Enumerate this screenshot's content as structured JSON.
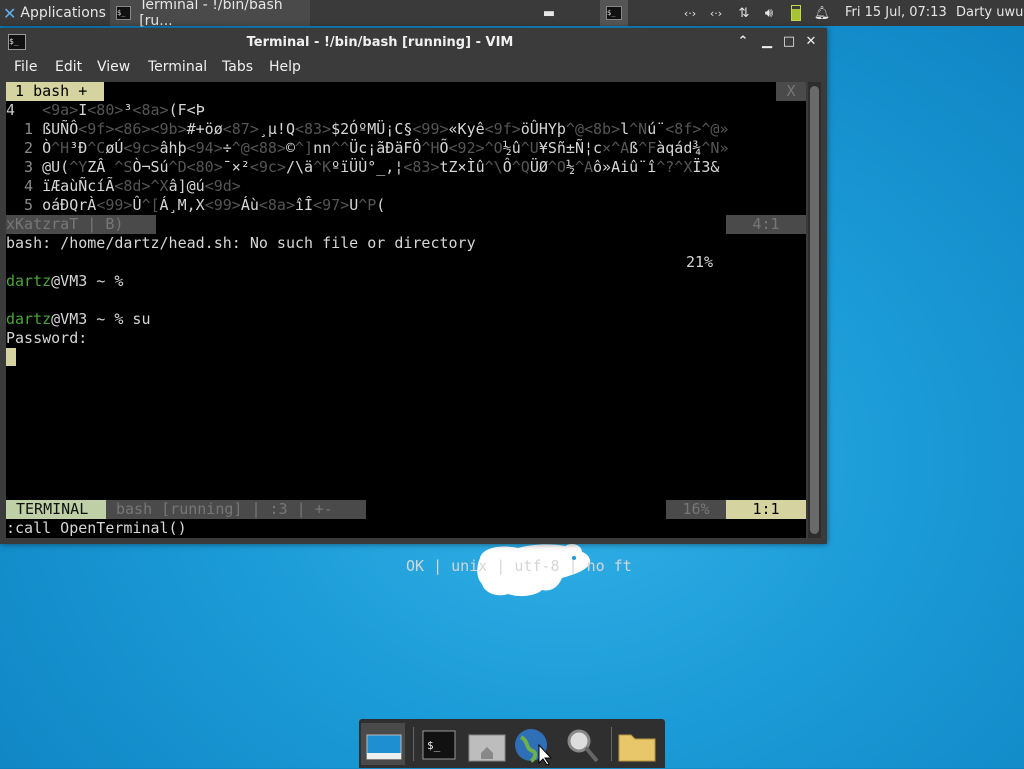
{
  "panel": {
    "applications_label": "Applications",
    "applications_suffix": "≡",
    "task_title": "Terminal - !/bin/bash [ru...",
    "clock": "Fri 15 Jul, 07:13",
    "user": "Darty uwu",
    "icons": [
      "app-x-icon",
      "window-min-icon",
      "workspace-icon",
      "network-icon",
      "network-icon",
      "transfer-icon",
      "volume-icon",
      "battery-icon",
      "notification-icon"
    ]
  },
  "window": {
    "title": "Terminal - !/bin/bash [running] - VIM",
    "menu": [
      "File",
      "Edit",
      "View",
      "Terminal",
      "Tabs",
      "Help"
    ]
  },
  "vim": {
    "tab_label": " 1 bash + ",
    "tab_close": "X",
    "line_cur_num": "4 ",
    "line_cur_a": "  <9a>",
    "line_cur_b": "I",
    "line_cur_c": "<80>",
    "line_cur_d": "³",
    "line_cur_e": "<8a>",
    "line_cur_f": "(F<Þ",
    "rows": [
      {
        "n": "1",
        "segs": [
          [
            "w",
            "ßUÑÔ"
          ],
          [
            "g",
            "<9f><86><9b>"
          ],
          [
            "w",
            "#+öø"
          ],
          [
            "g",
            "<87>"
          ],
          [
            "w",
            "¸µ!Q"
          ],
          [
            "g",
            "<83>"
          ],
          [
            "w",
            "$2ÓºMÜ¡C§"
          ],
          [
            "g",
            "<99>"
          ],
          [
            "w",
            "«Kyê"
          ],
          [
            "g",
            "<9f>"
          ],
          [
            "w",
            "öÛHYþ"
          ],
          [
            "g",
            "^@<8b>"
          ],
          [
            "w",
            "l"
          ],
          [
            "g",
            "^N"
          ],
          [
            "w",
            "ú¨"
          ],
          [
            "g",
            "<8f>^@»"
          ]
        ]
      },
      {
        "n": "2",
        "segs": [
          [
            "w",
            "Ò"
          ],
          [
            "g",
            "^H"
          ],
          [
            "w",
            "³Đ"
          ],
          [
            "g",
            "^C"
          ],
          [
            "w",
            "øÚ"
          ],
          [
            "g",
            "<9c>"
          ],
          [
            "w",
            "âhþ"
          ],
          [
            "g",
            "<94>"
          ],
          [
            "w",
            "÷"
          ],
          [
            "g",
            "^@<88>"
          ],
          [
            "w",
            "©"
          ],
          [
            "g",
            "^]"
          ],
          [
            "w",
            "nn"
          ],
          [
            "g",
            "^^"
          ],
          [
            "w",
            "Üc¡ãĐäFÔ"
          ],
          [
            "g",
            "^H"
          ],
          [
            "w",
            "Õ"
          ],
          [
            "g",
            "<92>^O"
          ],
          [
            "w",
            "½û"
          ],
          [
            "g",
            "^U"
          ],
          [
            "w",
            "¥Sñ±Ñ¦c"
          ],
          [
            "g",
            "×^A"
          ],
          [
            "w",
            "ß"
          ],
          [
            "g",
            "^F"
          ],
          [
            "w",
            "àqád¾"
          ],
          [
            "g",
            "^N»"
          ]
        ]
      },
      {
        "n": "3",
        "segs": [
          [
            "w",
            "@U("
          ],
          [
            "g",
            "^Y"
          ],
          [
            "w",
            "ZÂ"
          ],
          [
            "g",
            " ^S"
          ],
          [
            "w",
            "Ò¬Sú"
          ],
          [
            "g",
            "^D<80>"
          ],
          [
            "w",
            "¯×²"
          ],
          [
            "g",
            "<9c>"
          ],
          [
            "w",
            "/\\ä"
          ],
          [
            "g",
            "^K"
          ],
          [
            "w",
            "ºïÜÙ°_,¦"
          ],
          [
            "g",
            "<83>"
          ],
          [
            "w",
            "tZ×Ìû"
          ],
          [
            "g",
            "^\\"
          ],
          [
            "w",
            "Ô"
          ],
          [
            "g",
            "^Q"
          ],
          [
            "w",
            "ÜØ"
          ],
          [
            "g",
            "^O"
          ],
          [
            "w",
            "½"
          ],
          [
            "g",
            "^A"
          ],
          [
            "w",
            "ô»Aiû¨î"
          ],
          [
            "g",
            "^?^X"
          ],
          [
            "w",
            "Ï3&"
          ]
        ]
      },
      {
        "n": "4",
        "segs": [
          [
            "w",
            "ïÆaùÑcíÃ"
          ],
          [
            "g",
            "<8d>^X"
          ],
          [
            "w",
            "â]@ú"
          ],
          [
            "g",
            "<9d>"
          ]
        ]
      },
      {
        "n": "5",
        "segs": [
          [
            "w",
            "oáĐQrÀ"
          ],
          [
            "g",
            "<99>"
          ],
          [
            "w",
            "Û"
          ],
          [
            "g",
            "^["
          ],
          [
            "w",
            "Á¸M,X"
          ],
          [
            "g",
            "<99>"
          ],
          [
            "w",
            "Áù"
          ],
          [
            "g",
            "<8a>"
          ],
          [
            "w",
            "îÎ"
          ],
          [
            "g",
            "<97>"
          ],
          [
            "w",
            "U"
          ],
          [
            "g",
            "^P"
          ],
          [
            "w",
            "("
          ]
        ]
      }
    ],
    "status1_name": "xKatzraT | B)",
    "status1_percent": "21%",
    "status1_pos": "4:1",
    "output1": "bash: /home/dartz/head.sh: No such file or directory",
    "prompt_user": "dartz",
    "prompt_rest1": "@VM3 ~ %",
    "prompt_rest2": "@VM3 ~ % su",
    "password_prompt": "Password:",
    "status2_mode": "TERMINAL",
    "status2_buffer": "bash [running] | :3 | +-",
    "status2_info": "OK | unix | utf-8 | no ft",
    "status2_percent": "16%",
    "status2_pos": "1:1",
    "cmdline": ":call OpenTerminal()"
  },
  "dock": {
    "items": [
      "show-desktop-icon",
      "terminal-icon",
      "home-folder-icon",
      "web-browser-icon",
      "search-icon",
      "folder-icon"
    ]
  },
  "colors": {
    "desktop": "#1a9ad6",
    "vim_tab": "#d5d4a1",
    "prompt_green": "#4aa63a",
    "terminal_mode": "#bfd0a6"
  }
}
